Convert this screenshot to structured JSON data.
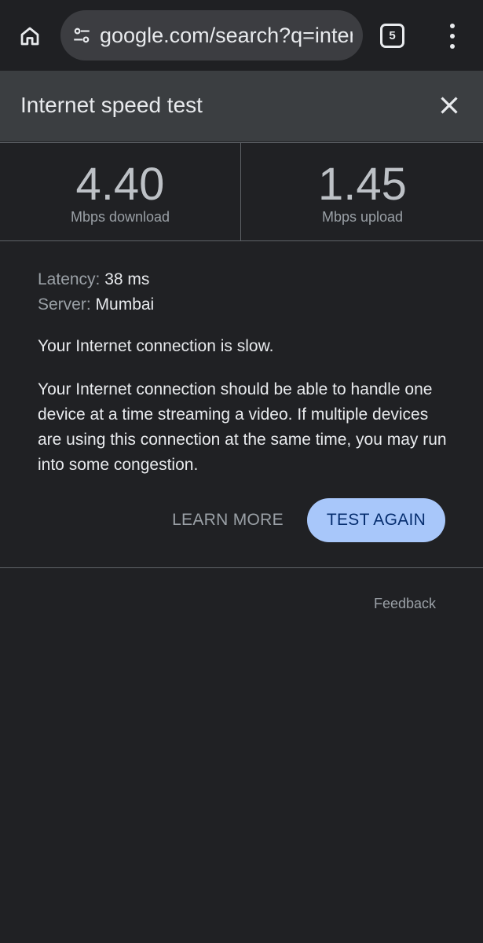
{
  "browser": {
    "url": "google.com/search?q=internet speed test",
    "tab_count": "5",
    "icons": [
      "home-icon",
      "site-settings-icon",
      "tabs-icon",
      "more-vert-icon"
    ]
  },
  "sheet": {
    "title": "Internet speed test",
    "close_icon": "close-icon"
  },
  "results": {
    "download_value": "4.40",
    "download_unit": "Mbps download",
    "upload_value": "1.45",
    "upload_unit": "Mbps upload",
    "latency_label": "Latency:",
    "latency_value": "38 ms",
    "server_label": "Server:",
    "server_value": "Mumbai",
    "status": "Your Internet connection is slow.",
    "description": "Your Internet connection should be able to handle one device at a time streaming a video. If multiple devices are using this connection at the same time, you may run into some congestion."
  },
  "actions": {
    "learn_more": "LEARN MORE",
    "test_again": "TEST AGAIN",
    "feedback": "Feedback"
  },
  "colors": {
    "background": "#202124",
    "header": "#3b3e41",
    "accent": "#a8c7fa"
  }
}
